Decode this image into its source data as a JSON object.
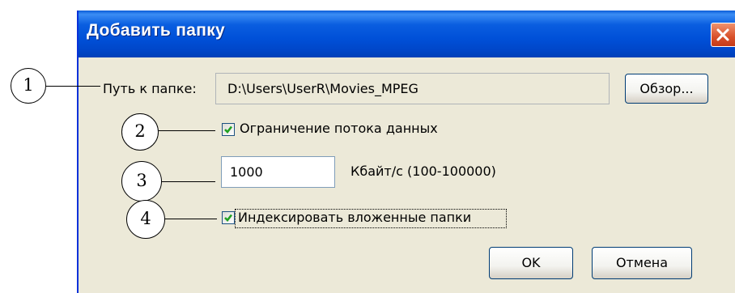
{
  "dialog": {
    "title": "Добавить папку",
    "close_icon": "close-icon",
    "accent_color": "#0054e3",
    "close_color": "#e0542e"
  },
  "path": {
    "label": "Путь к папке:",
    "value": "D:\\Users\\UserR\\Movies_MPEG",
    "browse_label": "Обзор..."
  },
  "limit": {
    "checked": true,
    "label": "Ограничение потока данных"
  },
  "rate": {
    "value": "1000",
    "unit_label": "Кбайт/с (100-100000)"
  },
  "index": {
    "checked": true,
    "label": "Индексировать вложенные папки"
  },
  "buttons": {
    "ok": "OK",
    "cancel": "Отмена"
  },
  "callouts": [
    "1",
    "2",
    "3",
    "4"
  ]
}
